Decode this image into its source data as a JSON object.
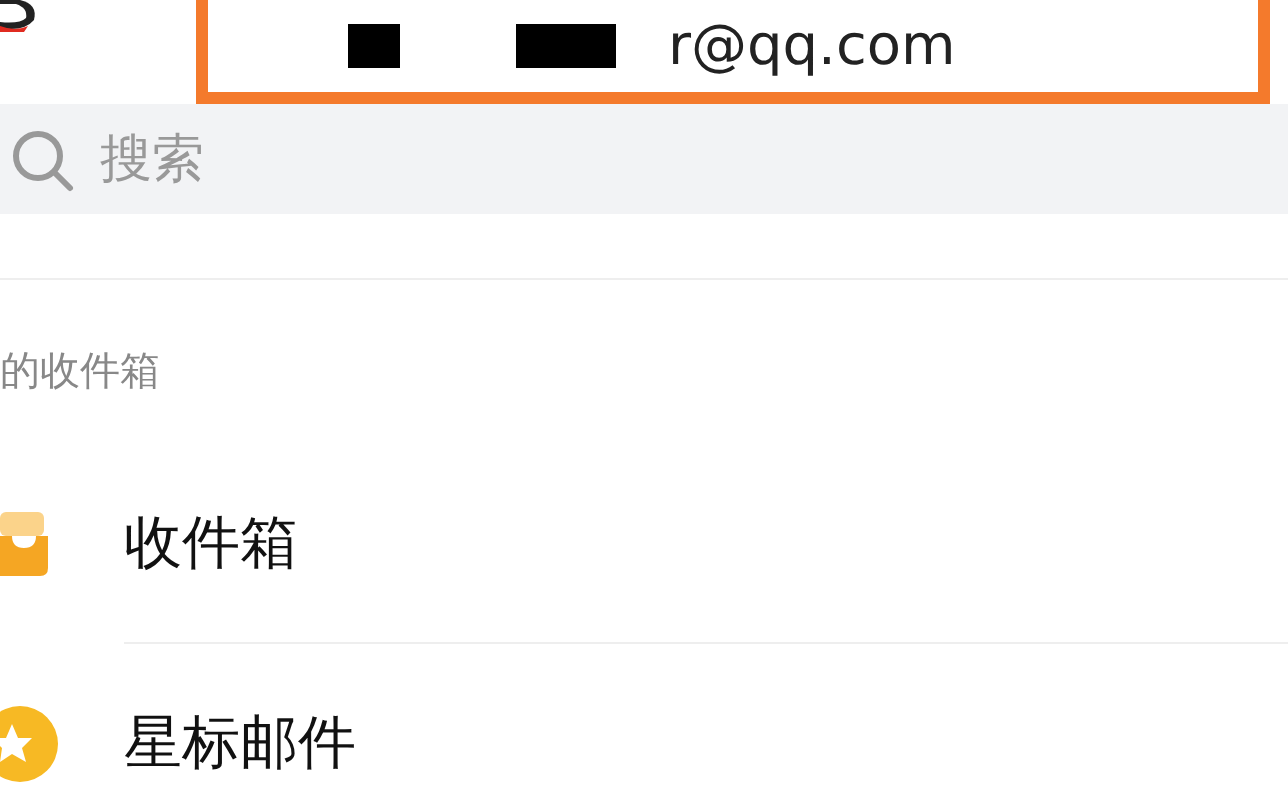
{
  "account": {
    "email": "r@qq.com"
  },
  "search": {
    "placeholder": "搜索"
  },
  "section": {
    "title": "的收件箱"
  },
  "folders": [
    {
      "label": "收件箱",
      "kind": "inbox"
    },
    {
      "label": "星标邮件",
      "kind": "star"
    }
  ]
}
